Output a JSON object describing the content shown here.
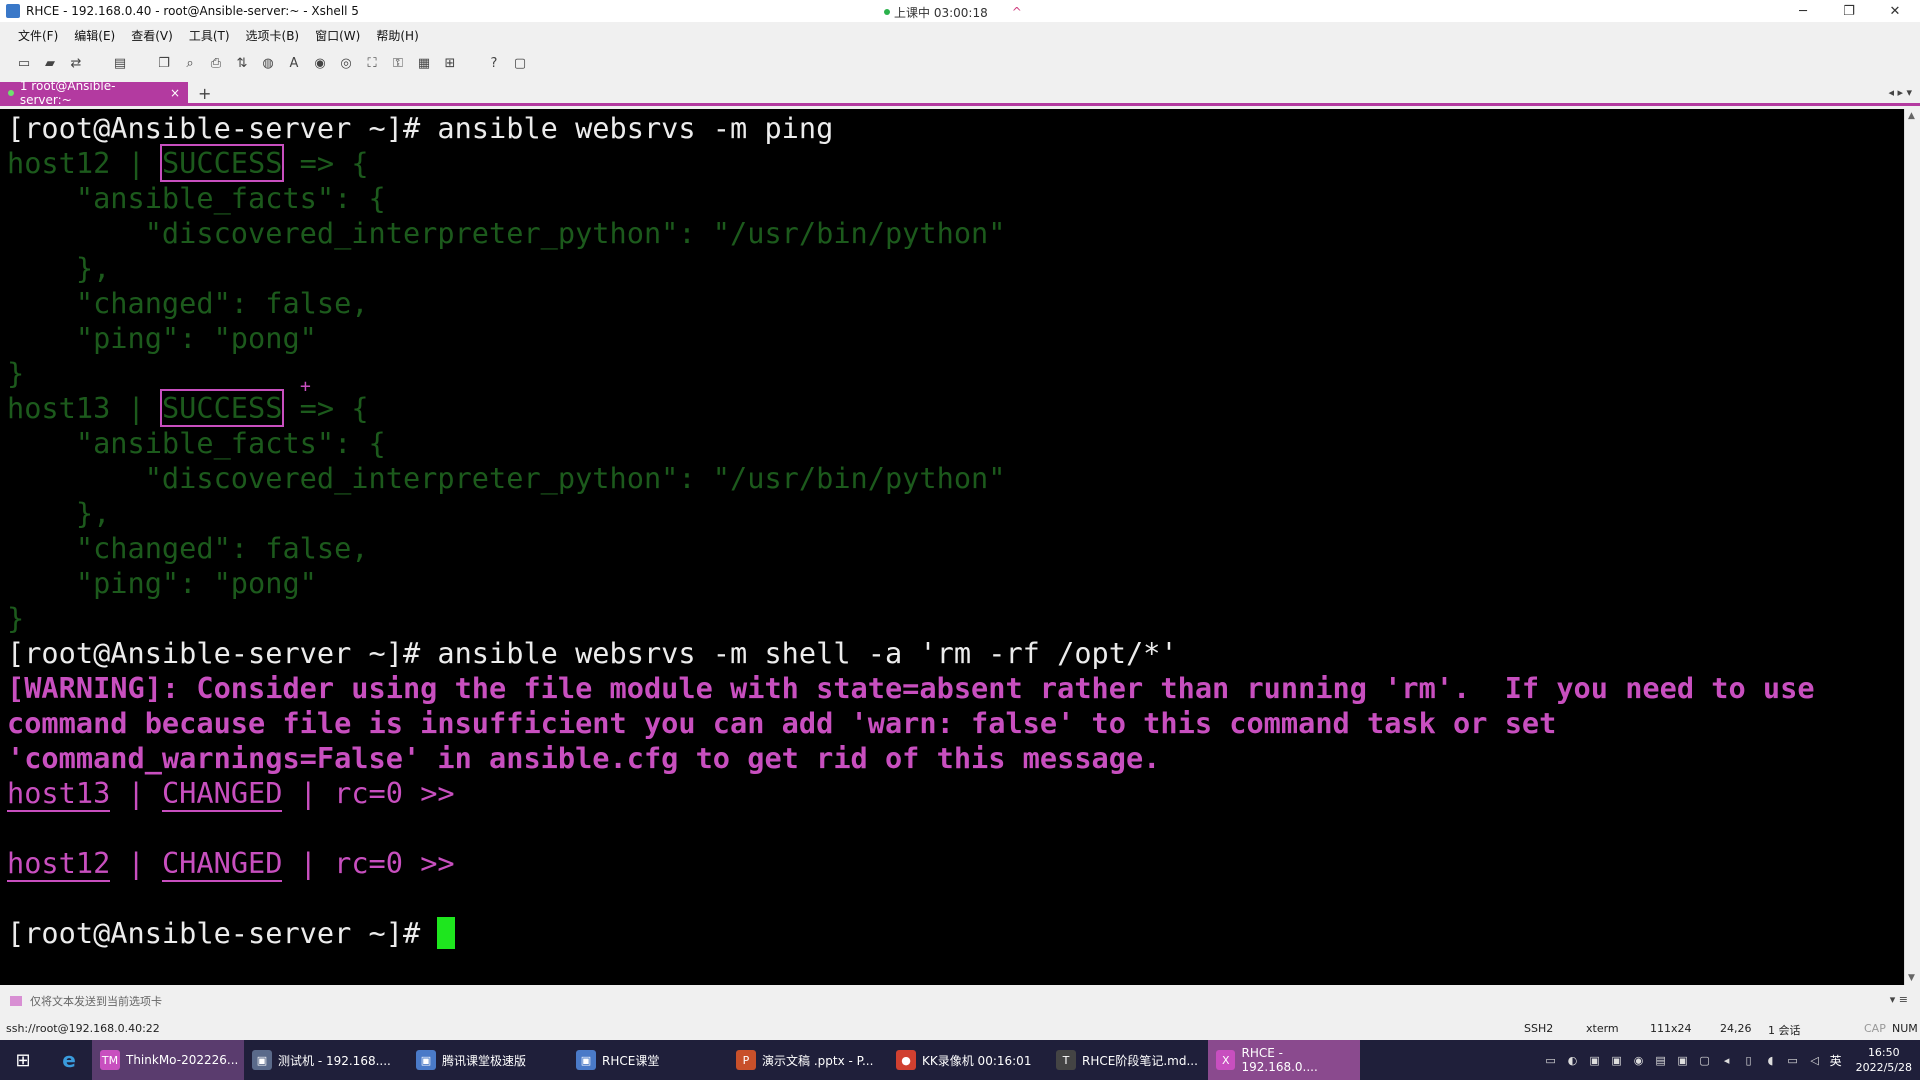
{
  "window": {
    "title": "RHCE - 192.168.0.40 - root@Ansible-server:~ - Xshell 5",
    "live_label": "上课中 03:00:18",
    "live_up": "^",
    "minimize": "─",
    "restore": "❐",
    "close": "✕"
  },
  "menu": [
    "文件(F)",
    "编辑(E)",
    "查看(V)",
    "工具(T)",
    "选项卡(B)",
    "窗口(W)",
    "帮助(H)"
  ],
  "tab": {
    "label": "1 root@Ansible-server:~",
    "close": "×",
    "add": "+"
  },
  "terminal": {
    "l1": "[root@Ansible-server ~]# ansible websrvs -m ping",
    "l2a": "host12 | ",
    "l2b": "SUCCESS",
    "l2c": " => {",
    "l3": "    \"ansible_facts\": {",
    "l4": "        \"discovered_interpreter_python\": \"/usr/bin/python\"",
    "l5": "    },",
    "l6": "    \"changed\": false,",
    "l7": "    \"ping\": \"pong\"",
    "l8": "}",
    "l9a": "host13 | ",
    "l9b": "SUCCESS",
    "l9c": " => {",
    "l10": "    \"ansible_facts\": {",
    "l11": "        \"discovered_interpreter_python\": \"/usr/bin/python\"",
    "l12": "    },",
    "l13": "    \"changed\": false,",
    "l14": "    \"ping\": \"pong\"",
    "l15": "}",
    "l16": "[root@Ansible-server ~]# ansible websrvs -m shell -a 'rm -rf /opt/*'",
    "l17": "[WARNING]: Consider using the file module with state=absent rather than running 'rm'.  If you need to use",
    "l18": "command because file is insufficient you can add 'warn: false' to this command task or set",
    "l19": "'command_warnings=False' in ansible.cfg to get rid of this message.",
    "l20a": "host13",
    "l20b": " | ",
    "l20c": "CHANGED",
    "l20d": " | rc=0 >>",
    "l21a": "host12",
    "l21b": " | ",
    "l21c": "CHANGED",
    "l21d": " | rc=0 >>",
    "l22": "[root@Ansible-server ~]# "
  },
  "compose": {
    "label": "仅将文本发送到当前选项卡"
  },
  "status": {
    "connection": "ssh://root@192.168.0.40:22",
    "protocol": "SSH2",
    "term": "xterm",
    "size": "111x24",
    "pos": "24,26",
    "sessions": "1 会话",
    "cap": "CAP",
    "num": "NUM"
  },
  "taskbar": {
    "apps": [
      {
        "label": "ThinkMo-202226...",
        "icon": "TM",
        "color": "#c84fbf"
      },
      {
        "label": "测试机 - 192.168....",
        "icon": "▣",
        "color": "#5a6a8a"
      },
      {
        "label": "腾讯课堂极速版",
        "icon": "▣",
        "color": "#4a7ac8"
      },
      {
        "label": "RHCE课堂",
        "icon": "▣",
        "color": "#4a7ac8"
      },
      {
        "label": "演示文稿 .pptx - P...",
        "icon": "P",
        "color": "#c8502a"
      },
      {
        "label": "KK录像机 00:16:01",
        "icon": "●",
        "color": "#d04030"
      },
      {
        "label": "RHCE阶段笔记.md...",
        "icon": "T",
        "color": "#444"
      },
      {
        "label": "RHCE - 192.168.0....",
        "icon": "X",
        "color": "#c84fbf"
      }
    ],
    "ime": "英",
    "time": "16:50",
    "date": "2022/5/28"
  }
}
